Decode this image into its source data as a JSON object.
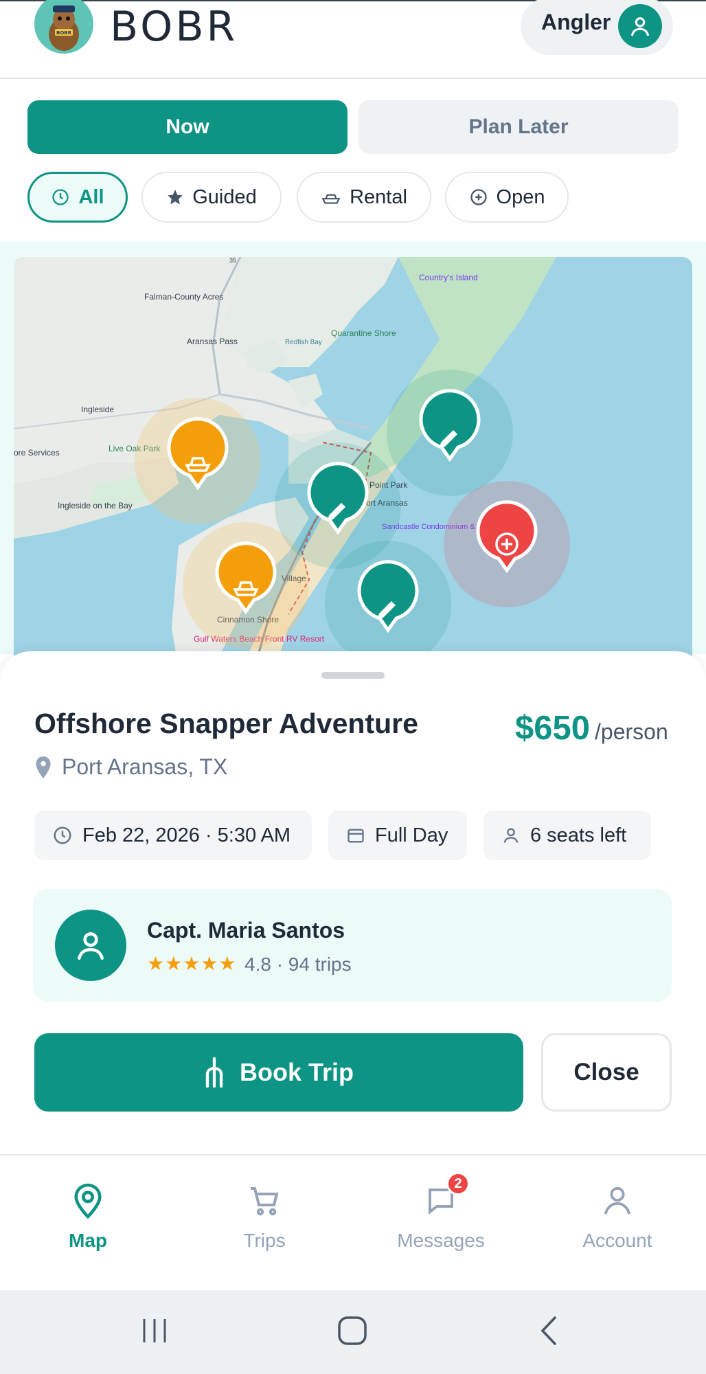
{
  "header": {
    "brand": "BOBR",
    "logo_text": "BOBR",
    "role_label": "Angler"
  },
  "mode": {
    "now_label": "Now",
    "later_label": "Plan Later",
    "selected": "Now"
  },
  "filters": [
    {
      "label": "All",
      "icon": "clock-icon",
      "active": true
    },
    {
      "label": "Guided",
      "icon": "star-icon",
      "active": false
    },
    {
      "label": "Rental",
      "icon": "boat-icon",
      "active": false
    },
    {
      "label": "Open",
      "icon": "plus-circle-icon",
      "active": false
    }
  ],
  "map": {
    "place_labels": [
      "Falman-County Acres",
      "Aransas Pass",
      "Redfish Bay",
      "Quarantine Shore",
      "Country's Island",
      "Ingleside",
      "Live Oak Park",
      "Ingleside on the Bay",
      "ore Services",
      "Point Park",
      "Port Aransas",
      "Sandcastle Condominium & Event Center",
      "Village",
      "Cinnamon Shore",
      "Gulf Waters Beach Front RV Resort",
      "35"
    ],
    "markers": [
      {
        "type": "rental",
        "color": "#f59e0b",
        "icon": "boat-icon"
      },
      {
        "type": "rental",
        "color": "#f59e0b",
        "icon": "boat-icon"
      },
      {
        "type": "guided",
        "color": "#0d9484",
        "icon": "pencil-icon"
      },
      {
        "type": "guided",
        "color": "#0d9484",
        "icon": "pencil-icon"
      },
      {
        "type": "guided",
        "color": "#0d9484",
        "icon": "pencil-icon"
      },
      {
        "type": "open",
        "color": "#ef4444",
        "icon": "plus-circle-icon"
      }
    ]
  },
  "trip": {
    "title": "Offshore Snapper Adventure",
    "price": "$650",
    "price_unit": "/person",
    "location": "Port Aransas, TX",
    "date_time": "Feb 22, 2026 · 5:30 AM",
    "duration": "Full Day",
    "seats": "6 seats left",
    "captain": {
      "name": "Capt. Maria Santos",
      "stars": "★★★★★",
      "meta": "4.8 · 94 trips"
    },
    "book_label": "Book Trip",
    "close_label": "Close"
  },
  "tabs": [
    {
      "label": "Map",
      "icon": "map-pin-icon",
      "active": true
    },
    {
      "label": "Trips",
      "icon": "cart-icon",
      "active": false
    },
    {
      "label": "Messages",
      "icon": "chat-icon",
      "active": false,
      "badge": "2"
    },
    {
      "label": "Account",
      "icon": "user-icon",
      "active": false
    }
  ],
  "colors": {
    "accent": "#0d9484",
    "rental": "#f59e0b",
    "open": "#ef4444",
    "muted": "#94a3b8"
  }
}
